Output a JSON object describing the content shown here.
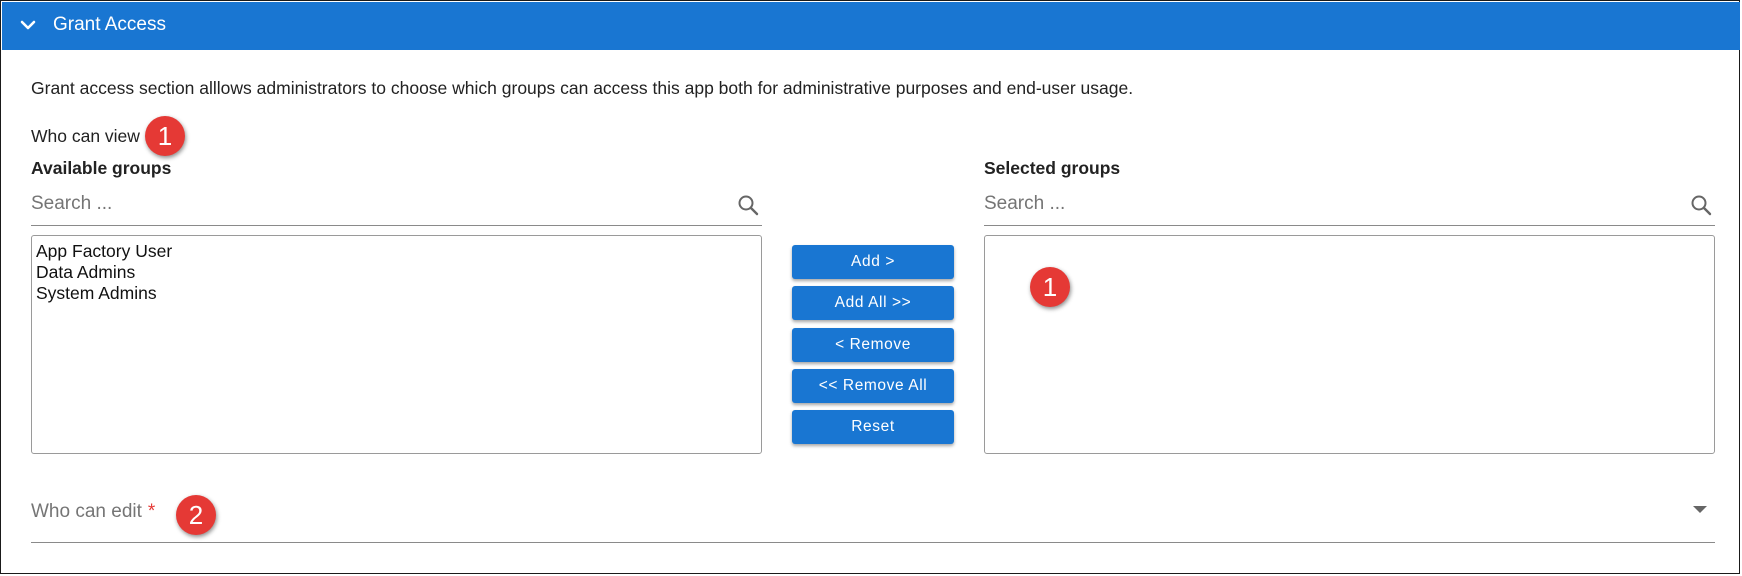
{
  "header": {
    "title": "Grant Access",
    "icon": "chevron-down-icon",
    "color": "#1976d2"
  },
  "description": "Grant access section alllows administrators to choose which groups can access this app both for administrative purposes and end-user usage.",
  "who_can_view": {
    "label": "Who can view",
    "badge": "1"
  },
  "available": {
    "title": "Available groups",
    "search_placeholder": "Search ...",
    "items": [
      "App Factory User",
      "Data Admins",
      "System Admins"
    ]
  },
  "selected": {
    "title": "Selected groups",
    "search_placeholder": "Search ...",
    "items": [],
    "badge": "1"
  },
  "buttons": {
    "add": "Add >",
    "add_all": "Add All >>",
    "remove": "< Remove",
    "remove_all": "<< Remove All",
    "reset": "Reset"
  },
  "who_can_edit": {
    "label": "Who can edit",
    "required_marker": "*",
    "badge": "2"
  },
  "colors": {
    "accent": "#1976d2",
    "badge": "#e53935"
  }
}
